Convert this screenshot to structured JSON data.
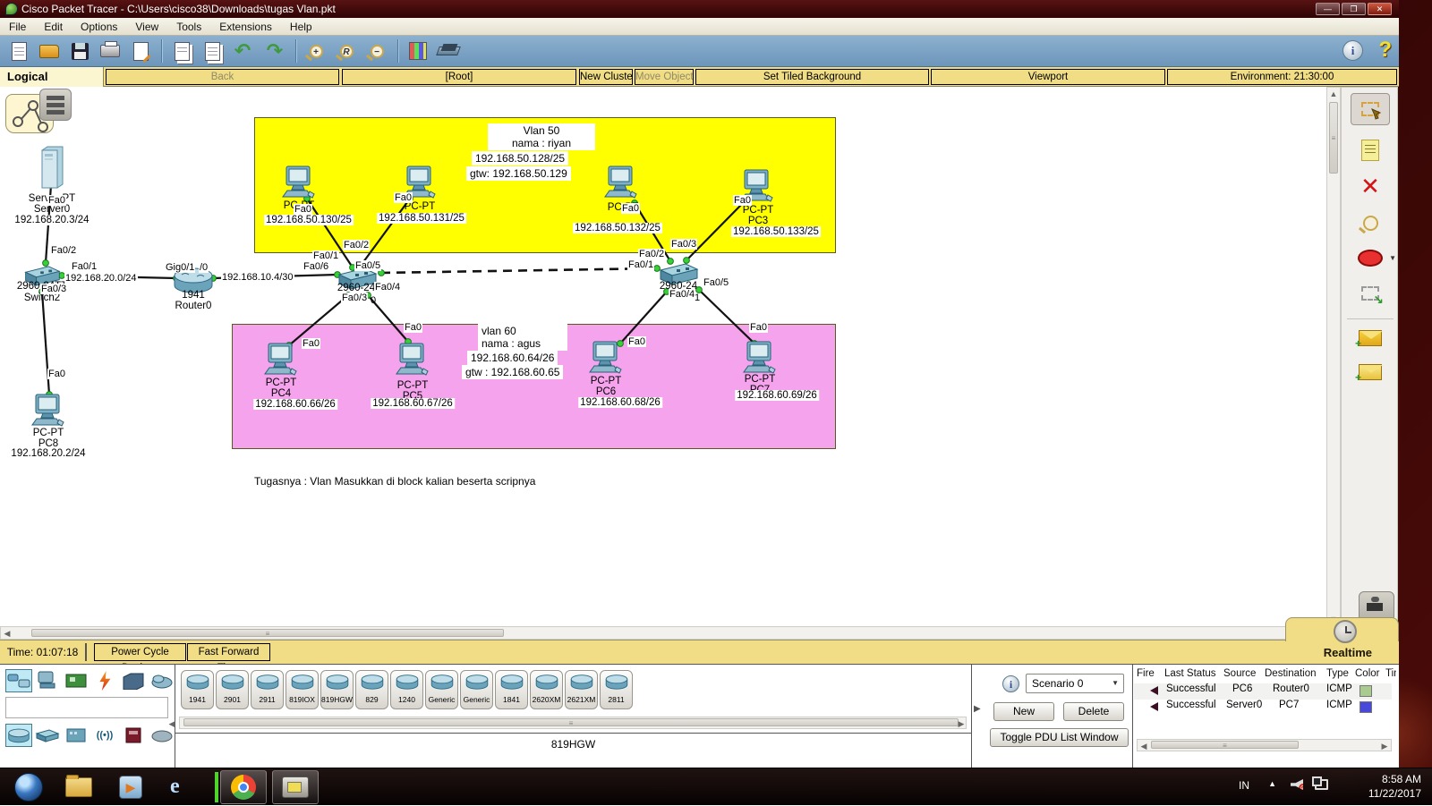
{
  "window": {
    "title": "Cisco Packet Tracer - C:\\Users\\cisco38\\Downloads\\tugas Vlan.pkt"
  },
  "menu": {
    "items": [
      "File",
      "Edit",
      "Options",
      "View",
      "Tools",
      "Extensions",
      "Help"
    ]
  },
  "toolbar": {
    "info": "i",
    "help": "?"
  },
  "navbar": {
    "logical": "Logical",
    "back": "Back",
    "root": "[Root]",
    "new_cluster": "New Cluster",
    "move_object": "Move Object",
    "set_tiled": "Set Tiled Background",
    "viewport": "Viewport",
    "environment": "Environment: 21:30:00"
  },
  "colors": {
    "vlan50": "#ffff00",
    "vlan60": "#f5a3ec",
    "pdu_row0": "#a9cb8f",
    "pdu_row1": "#4949d9"
  },
  "topology": {
    "vlan50": {
      "title": "Vlan 50",
      "subtitle": "nama : riyan",
      "network": "192.168.50.128/25",
      "gateway": "gtw: 192.168.50.129"
    },
    "vlan60": {
      "title": "vlan 60",
      "subtitle": "nama : agus",
      "network": "192.168.60.64/26",
      "gateway": "gtw : 192.168.60.65"
    },
    "note": "Tugasnya : Vlan Masukkan di block kalian beserta scripnya",
    "link_labels": {
      "lan20": "192.168.20.0/24",
      "wan10": "192.168.10.4/30"
    },
    "devices": {
      "server0": {
        "model": "Server-PT",
        "name": "Server0",
        "ip": "192.168.20.3/24"
      },
      "switch2": {
        "model": "2960-24TT",
        "name": "Switch2"
      },
      "router0": {
        "model": "1941",
        "name": "Router0"
      },
      "switch0": {
        "model": "2960-24",
        "remnant": "0"
      },
      "switch1": {
        "model": "2960-24",
        "remnant": "1"
      },
      "pc0": {
        "model": "PC-PT",
        "ip": "192.168.50.130/25"
      },
      "pc1": {
        "model": "PC-PT",
        "ip": "192.168.50.131/25"
      },
      "pc2": {
        "model": "PC-PT",
        "ip": "192.168.50.132/25"
      },
      "pc3": {
        "model": "PC-PT",
        "name": "PC3",
        "ip": "192.168.50.133/25"
      },
      "pc4": {
        "model": "PC-PT",
        "name": "PC4",
        "ip": "192.168.60.66/26"
      },
      "pc5": {
        "model": "PC-PT",
        "name": "PC5",
        "ip": "192.168.60.67/26"
      },
      "pc6": {
        "model": "PC-PT",
        "name": "PC6",
        "ip": "192.168.60.68/26"
      },
      "pc7": {
        "model": "PC-PT",
        "name": "PC7",
        "ip": "192.168.60.69/26"
      },
      "pc8": {
        "model": "PC-PT",
        "name": "PC8",
        "ip": "192.168.20.2/24"
      }
    },
    "ports": {
      "fa0": "Fa0",
      "sw2_fa01": "Fa0/1",
      "sw2_fa02": "Fa0/2",
      "sw2_fa03": "Fa0/3",
      "r0_gig01": "Gig0/1",
      "r0_gig00": "/0",
      "sw0_fa01": "Fa0/1",
      "sw0_fa02": "Fa0/2",
      "sw0_fa03": "Fa0/3",
      "sw0_fa04": "Fa0/4",
      "sw0_fa05": "Fa0/5",
      "sw0_fa06": "Fa0/6",
      "sw1_fa01": "Fa0/1",
      "sw1_fa02": "Fa0/2",
      "sw1_fa03": "Fa0/3",
      "sw1_fa04": "Fa0/4",
      "sw1_fa05": "Fa0/5"
    }
  },
  "statusbar": {
    "time": "Time: 01:07:18",
    "power_cycle": "Power Cycle Devices",
    "fast_forward": "Fast Forward Time",
    "realtime": "Realtime"
  },
  "palette": {
    "models": [
      "1941",
      "2901",
      "2911",
      "819IOX",
      "819HGW",
      "829",
      "1240",
      "Generic",
      "Generic",
      "1841",
      "2620XM",
      "2621XM",
      "2811"
    ],
    "selected": "819HGW"
  },
  "scenario": {
    "name": "Scenario 0",
    "new": "New",
    "delete": "Delete",
    "toggle": "Toggle PDU List Window"
  },
  "pdu": {
    "headers": [
      "Fire",
      "Last Status",
      "Source",
      "Destination",
      "Type",
      "Color",
      "Time"
    ],
    "rows": [
      {
        "status": "Successful",
        "source": "PC6",
        "destination": "Router0",
        "type": "ICMP",
        "color": "#a9cb8f"
      },
      {
        "status": "Successful",
        "source": "Server0",
        "destination": "PC7",
        "type": "ICMP",
        "color": "#4949d9"
      }
    ]
  },
  "taskbar": {
    "lang": "IN",
    "time": "8:58 AM",
    "date": "11/22/2017"
  }
}
